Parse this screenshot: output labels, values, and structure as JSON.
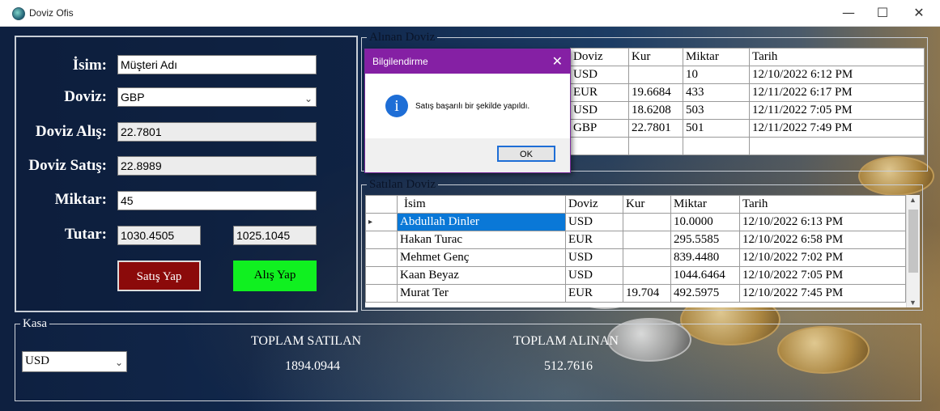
{
  "window": {
    "title": "Doviz Ofis",
    "minimize": "—",
    "maximize": "☐",
    "close": "✕"
  },
  "form": {
    "isim_label": "İsim:",
    "isim_value": "Müşteri Adı",
    "doviz_label": "Doviz:",
    "doviz_value": "GBP",
    "alis_label": "Doviz Alış:",
    "alis_value": "22.7801",
    "satis_label": "Doviz Satış:",
    "satis_value": "22.8989",
    "miktar_label": "Miktar:",
    "miktar_value": "45",
    "tutar_label": "Tutar:",
    "tutar_satis": "1030.4505",
    "tutar_alis": "1025.1045",
    "satis_button": "Satış Yap",
    "alis_button": "Alış Yap"
  },
  "alinan": {
    "legend": "Alınan Doviz",
    "columns": [
      "Doviz",
      "Kur",
      "Miktar",
      "Tarih"
    ],
    "rows": [
      [
        "USD",
        "",
        "10",
        "12/10/2022 6:12 PM"
      ],
      [
        "EUR",
        "19.6684",
        "433",
        "12/11/2022 6:17 PM"
      ],
      [
        "USD",
        "18.6208",
        "503",
        "12/11/2022 7:05 PM"
      ],
      [
        "GBP",
        "22.7801",
        "501",
        "12/11/2022 7:49 PM"
      ],
      [
        "",
        "",
        "",
        ""
      ]
    ]
  },
  "satilan": {
    "legend": "Satılan Doviz",
    "columns": [
      "",
      "İsim",
      "Doviz",
      "Kur",
      "Miktar",
      "Tarih"
    ],
    "rows": [
      [
        "▸",
        "Abdullah Dinler",
        "USD",
        "",
        "10.0000",
        "12/10/2022 6:13 PM"
      ],
      [
        "",
        "Hakan Turac",
        "EUR",
        "",
        "295.5585",
        "12/10/2022 6:58 PM"
      ],
      [
        "",
        "Mehmet Genç",
        "USD",
        "",
        "839.4480",
        "12/10/2022 7:02 PM"
      ],
      [
        "",
        "Kaan Beyaz",
        "USD",
        "",
        "1044.6464",
        "12/10/2022 7:05 PM"
      ],
      [
        "",
        "Murat Ter",
        "EUR",
        "19.704",
        "492.5975",
        "12/10/2022 7:45 PM"
      ]
    ]
  },
  "kasa": {
    "legend": "Kasa",
    "currency": "USD",
    "toplam_satilan_label": "TOPLAM SATILAN",
    "toplam_satilan_value": "1894.0944",
    "toplam_alinan_label": "TOPLAM ALINAN",
    "toplam_alinan_value": "512.7616"
  },
  "dialog": {
    "title": "Bilgilendirme",
    "message": "Satış başarılı bir şekilde yapıldı.",
    "ok": "OK",
    "close": "✕",
    "icon_glyph": "i"
  }
}
